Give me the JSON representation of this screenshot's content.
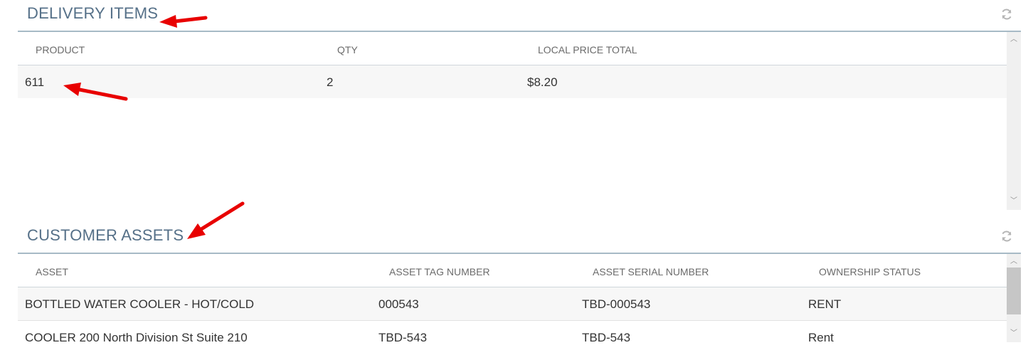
{
  "delivery_items": {
    "title": "DELIVERY ITEMS",
    "columns": [
      "PRODUCT",
      "QTY",
      "LOCAL PRICE TOTAL"
    ],
    "rows": [
      {
        "product": "611",
        "qty": "2",
        "local_price_total": "$8.20"
      }
    ],
    "refresh_icon": "refresh-icon"
  },
  "customer_assets": {
    "title": "CUSTOMER ASSETS",
    "columns": [
      "ASSET",
      "ASSET TAG NUMBER",
      "ASSET SERIAL NUMBER",
      "OWNERSHIP STATUS"
    ],
    "rows": [
      {
        "asset": "BOTTLED WATER COOLER - HOT/COLD",
        "tag": "000543",
        "serial": "TBD-000543",
        "ownership": "RENT"
      },
      {
        "asset": "COOLER 200 North Division St Suite 210",
        "tag": "TBD-543",
        "serial": "TBD-543",
        "ownership": "Rent"
      }
    ],
    "refresh_icon": "refresh-icon"
  },
  "colors": {
    "title": "#557088",
    "rule": "#a7bac6",
    "row_stripe": "#f7f7f7",
    "annotation_arrow": "#ee0000"
  }
}
